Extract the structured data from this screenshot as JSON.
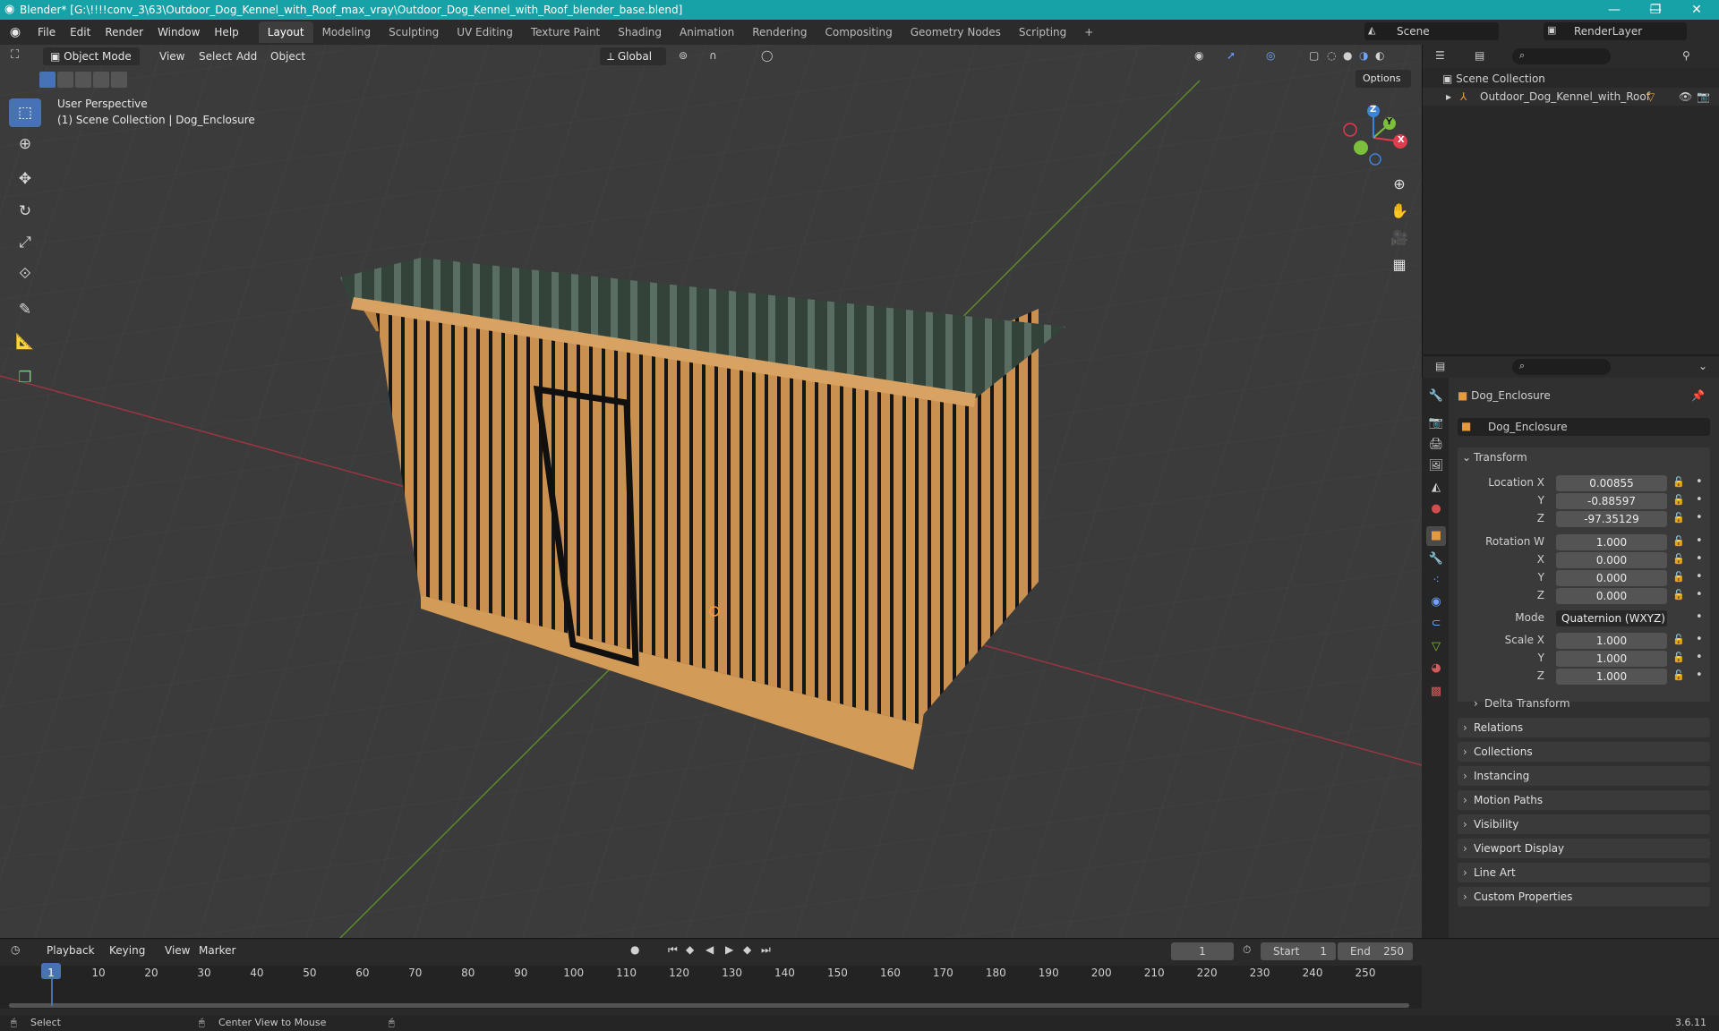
{
  "window": {
    "title": "Blender* [G:\\!!!!conv_3\\63\\Outdoor_Dog_Kennel_with_Roof_max_vray\\Outdoor_Dog_Kennel_with_Roof_blender_base.blend]",
    "min": "—",
    "max": "❐",
    "close": "✕"
  },
  "menu": [
    "File",
    "Edit",
    "Render",
    "Window",
    "Help"
  ],
  "workspaces": [
    "Layout",
    "Modeling",
    "Sculpting",
    "UV Editing",
    "Texture Paint",
    "Shading",
    "Animation",
    "Rendering",
    "Compositing",
    "Geometry Nodes",
    "Scripting",
    "+"
  ],
  "scene": {
    "name": "Scene",
    "render_layer": "RenderLayer"
  },
  "viewport": {
    "mode": "Object Mode",
    "menus": [
      "View",
      "Select",
      "Add",
      "Object"
    ],
    "orientation": "Global",
    "options": "Options",
    "perspective": "User Perspective",
    "collection_info": "(1) Scene Collection | Dog_Enclosure",
    "gizmo": {
      "x": "X",
      "y": "Y",
      "z": "Z"
    }
  },
  "outliner": {
    "root": "Scene Collection",
    "item": "Outdoor_Dog_Kennel_with_Roof"
  },
  "properties": {
    "object_name": "Dog_Enclosure",
    "data_name": "Dog_Enclosure",
    "section": "Transform",
    "location": {
      "label": "Location X",
      "x": "0.00855",
      "y": "-0.88597",
      "z": "-97.35129"
    },
    "rotation": {
      "label": "Rotation W",
      "w": "1.000",
      "x": "0.000",
      "y": "0.000",
      "z": "0.000"
    },
    "mode_label": "Mode",
    "mode": "Quaternion (WXYZ)",
    "scale": {
      "label": "Scale X",
      "x": "1.000",
      "y": "1.000",
      "z": "1.000"
    },
    "axis_labels": {
      "x": "X",
      "y": "Y",
      "z": "Z"
    },
    "delta": "Delta Transform",
    "panels": [
      "Relations",
      "Collections",
      "Instancing",
      "Motion Paths",
      "Visibility",
      "Viewport Display",
      "Line Art",
      "Custom Properties"
    ]
  },
  "timeline": {
    "menus": [
      "Playback",
      "Keying",
      "View",
      "Marker"
    ],
    "current_frame": "1",
    "start_label": "Start",
    "start": "1",
    "end_label": "End",
    "end": "250",
    "ticks": [
      "1",
      "10",
      "20",
      "30",
      "40",
      "50",
      "60",
      "70",
      "80",
      "90",
      "100",
      "110",
      "120",
      "130",
      "140",
      "150",
      "160",
      "170",
      "180",
      "190",
      "200",
      "210",
      "220",
      "230",
      "240",
      "250"
    ]
  },
  "status": {
    "select": "Select",
    "center": "Center View to Mouse",
    "version": "3.6.11"
  },
  "colors": {
    "accent": "#4772b3",
    "titlebar": "#17a2a8",
    "x_axis": "#e23b4e",
    "y_axis": "#7bbf3b",
    "z_axis": "#3e83d8"
  }
}
